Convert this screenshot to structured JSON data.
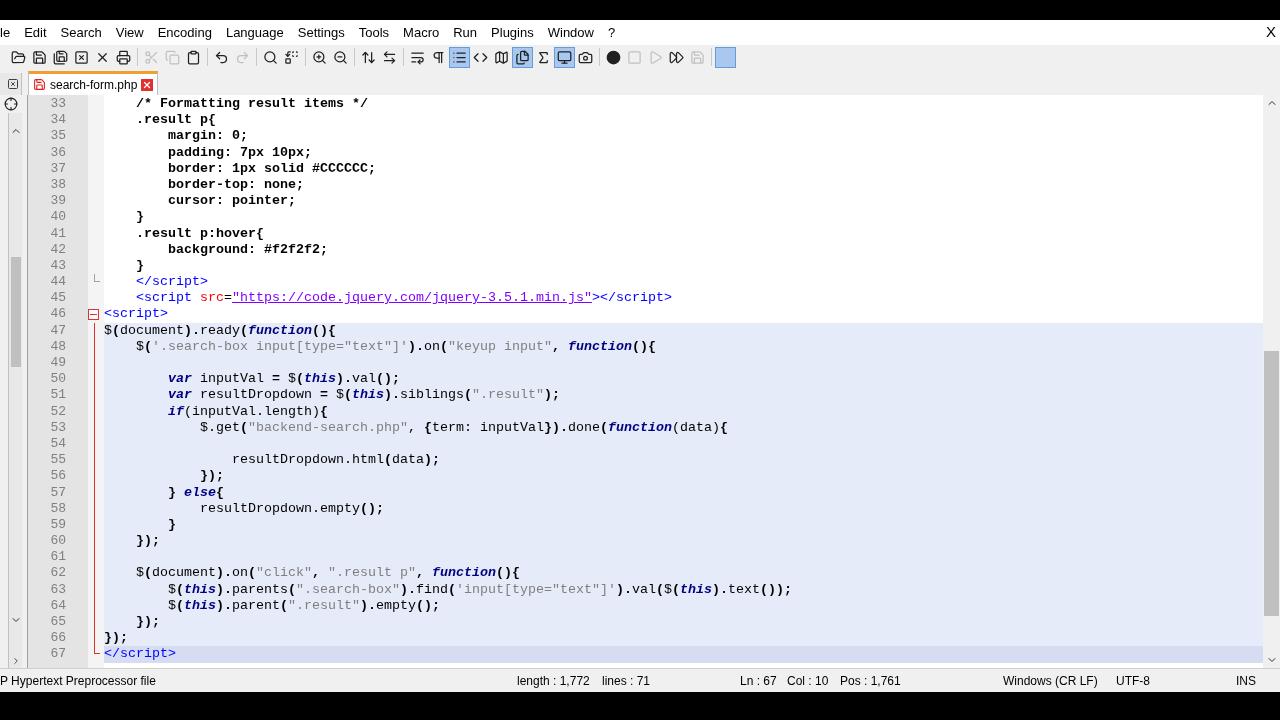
{
  "menu": [
    "le",
    "Edit",
    "Search",
    "View",
    "Encoding",
    "Language",
    "Settings",
    "Tools",
    "Macro",
    "Run",
    "Plugins",
    "Window",
    "?"
  ],
  "close_label": "X",
  "toolbar": [
    {
      "pressed": false,
      "disabled": false
    },
    {
      "pressed": false,
      "disabled": false
    },
    {
      "pressed": false,
      "disabled": false
    },
    {
      "pressed": false,
      "disabled": false
    },
    {
      "pressed": false,
      "disabled": false
    },
    {
      "pressed": false,
      "disabled": false
    },
    {
      "pressed": false,
      "disabled": true
    },
    {
      "pressed": false,
      "disabled": true
    },
    {
      "pressed": false,
      "disabled": false
    },
    {
      "pressed": false,
      "disabled": false
    },
    {
      "pressed": false,
      "disabled": true
    },
    {
      "pressed": false,
      "disabled": false
    },
    {
      "pressed": false,
      "disabled": false
    },
    {
      "pressed": false,
      "disabled": false
    },
    {
      "pressed": false,
      "disabled": false
    },
    {
      "pressed": false,
      "disabled": false
    },
    {
      "pressed": false,
      "disabled": false
    },
    {
      "pressed": false,
      "disabled": false
    },
    {
      "pressed": false,
      "disabled": false
    },
    {
      "pressed": true,
      "disabled": false
    },
    {
      "pressed": false,
      "disabled": false
    },
    {
      "pressed": false,
      "disabled": false
    },
    {
      "pressed": true,
      "disabled": false
    },
    {
      "pressed": false,
      "disabled": false
    },
    {
      "pressed": true,
      "disabled": false
    },
    {
      "pressed": false,
      "disabled": false
    },
    {
      "pressed": false,
      "disabled": false
    },
    {
      "pressed": false,
      "disabled": true
    },
    {
      "pressed": false,
      "disabled": true
    },
    {
      "pressed": false,
      "disabled": false
    },
    {
      "pressed": false,
      "disabled": true
    },
    {
      "pressed": true,
      "disabled": false
    }
  ],
  "tabs": [
    {
      "label": "search-form.php",
      "selected": true,
      "modified": true
    }
  ],
  "lines": [
    {
      "number": "33",
      "kind": "plain",
      "current": false,
      "shaded": false,
      "tokens": [
        {
          "kind": "bold",
          "text": "    /* Formatting result items */"
        }
      ]
    },
    {
      "number": "34",
      "kind": "plain",
      "current": false,
      "shaded": false,
      "tokens": [
        {
          "kind": "bold",
          "text": "    .result p{"
        }
      ]
    },
    {
      "number": "35",
      "kind": "plain",
      "current": false,
      "shaded": false,
      "tokens": [
        {
          "kind": "bold",
          "text": "        margin: 0;"
        }
      ]
    },
    {
      "number": "36",
      "kind": "plain",
      "current": false,
      "shaded": false,
      "tokens": [
        {
          "kind": "bold",
          "text": "        padding: 7px 10px;"
        }
      ]
    },
    {
      "number": "37",
      "kind": "plain",
      "current": false,
      "shaded": false,
      "tokens": [
        {
          "kind": "bold",
          "text": "        border: 1px solid #CCCCCC;"
        }
      ]
    },
    {
      "number": "38",
      "kind": "plain",
      "current": false,
      "shaded": false,
      "tokens": [
        {
          "kind": "bold",
          "text": "        border-top: none;"
        }
      ]
    },
    {
      "number": "39",
      "kind": "plain",
      "current": false,
      "shaded": false,
      "tokens": [
        {
          "kind": "bold",
          "text": "        cursor: pointer;"
        }
      ]
    },
    {
      "number": "40",
      "kind": "plain",
      "current": false,
      "shaded": false,
      "tokens": [
        {
          "kind": "bold",
          "text": "    }"
        }
      ]
    },
    {
      "number": "41",
      "kind": "plain",
      "current": false,
      "shaded": false,
      "tokens": [
        {
          "kind": "bold",
          "text": "    .result p:hover{"
        }
      ]
    },
    {
      "number": "42",
      "kind": "plain",
      "current": false,
      "shaded": false,
      "tokens": [
        {
          "kind": "bold",
          "text": "        background: #f2f2f2;"
        }
      ]
    },
    {
      "number": "43",
      "kind": "plain",
      "current": false,
      "shaded": false,
      "tokens": [
        {
          "kind": "bold",
          "text": "    }"
        }
      ]
    },
    {
      "number": "44",
      "kind": "fold_end",
      "current": false,
      "shaded": false,
      "tokens": [
        {
          "kind": "tag",
          "text": "    </script>"
        }
      ]
    },
    {
      "number": "45",
      "kind": "plain",
      "current": false,
      "shaded": false,
      "tokens": [
        {
          "kind": "tag",
          "text": "    <script"
        },
        {
          "kind": "attr",
          "text": " src"
        },
        {
          "kind": "plain",
          "text": "="
        },
        {
          "kind": "url",
          "text": "\"https://code.jquery.com/jquery-3.5.1.min.js\""
        },
        {
          "kind": "tag",
          "text": "></script>"
        }
      ]
    },
    {
      "number": "46",
      "kind": "fold_start",
      "current": false,
      "shaded": false,
      "tokens": [
        {
          "kind": "tag",
          "text": "<script>"
        }
      ]
    },
    {
      "number": "47",
      "kind": "fold_body",
      "current": false,
      "shaded": true,
      "tokens": [
        {
          "kind": "plain",
          "text": "$"
        },
        {
          "kind": "op",
          "text": "("
        },
        {
          "kind": "plain",
          "text": "document"
        },
        {
          "kind": "op",
          "text": ")."
        },
        {
          "kind": "plain",
          "text": "ready"
        },
        {
          "kind": "op",
          "text": "("
        },
        {
          "kind": "keyword",
          "text": "function"
        },
        {
          "kind": "op",
          "text": "(){"
        }
      ]
    },
    {
      "number": "48",
      "kind": "fold_body",
      "current": false,
      "shaded": true,
      "tokens": [
        {
          "kind": "plain",
          "text": "    $"
        },
        {
          "kind": "op",
          "text": "("
        },
        {
          "kind": "string",
          "text": "'.search-box input[type=\"text\"]'"
        },
        {
          "kind": "op",
          "text": ")."
        },
        {
          "kind": "plain",
          "text": "on"
        },
        {
          "kind": "op",
          "text": "("
        },
        {
          "kind": "string",
          "text": "\"keyup input\""
        },
        {
          "kind": "op",
          "text": ", "
        },
        {
          "kind": "keyword",
          "text": "function"
        },
        {
          "kind": "op",
          "text": "(){"
        }
      ]
    },
    {
      "number": "49",
      "kind": "fold_body",
      "current": false,
      "shaded": true
    },
    {
      "number": "50",
      "kind": "fold_body",
      "current": false,
      "shaded": true,
      "tokens": [
        {
          "kind": "keyword",
          "text": "        var"
        },
        {
          "kind": "plain",
          "text": " inputVal "
        },
        {
          "kind": "op",
          "text": "="
        },
        {
          "kind": "plain",
          "text": " $"
        },
        {
          "kind": "op",
          "text": "("
        },
        {
          "kind": "keyword",
          "text": "this"
        },
        {
          "kind": "op",
          "text": ")."
        },
        {
          "kind": "plain",
          "text": "val"
        },
        {
          "kind": "op",
          "text": "();"
        }
      ]
    },
    {
      "number": "51",
      "kind": "fold_body",
      "current": false,
      "shaded": true,
      "tokens": [
        {
          "kind": "keyword",
          "text": "        var"
        },
        {
          "kind": "plain",
          "text": " resultDropdown "
        },
        {
          "kind": "op",
          "text": "="
        },
        {
          "kind": "plain",
          "text": " $"
        },
        {
          "kind": "op",
          "text": "("
        },
        {
          "kind": "keyword",
          "text": "this"
        },
        {
          "kind": "op",
          "text": ")."
        },
        {
          "kind": "plain",
          "text": "siblings"
        },
        {
          "kind": "op",
          "text": "("
        },
        {
          "kind": "string",
          "text": "\".result\""
        },
        {
          "kind": "op",
          "text": ");"
        }
      ]
    },
    {
      "number": "52",
      "kind": "fold_body",
      "current": false,
      "shaded": true,
      "tokens": [
        {
          "kind": "keyword",
          "text": "        if"
        },
        {
          "kind": "plain",
          "text": "(inputVal.length)"
        },
        {
          "kind": "op",
          "text": "{"
        }
      ]
    },
    {
      "number": "53",
      "kind": "fold_body",
      "current": false,
      "shaded": true,
      "tokens": [
        {
          "kind": "plain",
          "text": "            $.get"
        },
        {
          "kind": "op",
          "text": "("
        },
        {
          "kind": "string",
          "text": "\"backend-search.php\""
        },
        {
          "kind": "plain",
          "text": ", "
        },
        {
          "kind": "op",
          "text": "{"
        },
        {
          "kind": "plain",
          "text": "term: inputVal"
        },
        {
          "kind": "op",
          "text": "})."
        },
        {
          "kind": "plain",
          "text": "done"
        },
        {
          "kind": "op",
          "text": "("
        },
        {
          "kind": "keyword",
          "text": "function"
        },
        {
          "kind": "plain",
          "text": "(data)"
        },
        {
          "kind": "op",
          "text": "{"
        }
      ]
    },
    {
      "number": "54",
      "kind": "fold_body",
      "current": false,
      "shaded": true
    },
    {
      "number": "55",
      "kind": "fold_body",
      "current": false,
      "shaded": true,
      "tokens": [
        {
          "kind": "plain",
          "text": "                resultDropdown.html"
        },
        {
          "kind": "op",
          "text": "("
        },
        {
          "kind": "plain",
          "text": "data"
        },
        {
          "kind": "op",
          "text": ");"
        }
      ]
    },
    {
      "number": "56",
      "kind": "fold_body",
      "current": false,
      "shaded": true,
      "tokens": [
        {
          "kind": "op",
          "text": "            });"
        }
      ]
    },
    {
      "number": "57",
      "kind": "fold_body",
      "current": false,
      "shaded": true,
      "tokens": [
        {
          "kind": "op",
          "text": "        } "
        },
        {
          "kind": "keyword",
          "text": "else"
        },
        {
          "kind": "op",
          "text": "{"
        }
      ]
    },
    {
      "number": "58",
      "kind": "fold_body",
      "current": false,
      "shaded": true,
      "tokens": [
        {
          "kind": "plain",
          "text": "            resultDropdown.empty"
        },
        {
          "kind": "op",
          "text": "();"
        }
      ]
    },
    {
      "number": "59",
      "kind": "fold_body",
      "current": false,
      "shaded": true,
      "tokens": [
        {
          "kind": "op",
          "text": "        }"
        }
      ]
    },
    {
      "number": "60",
      "kind": "fold_body",
      "current": false,
      "shaded": true,
      "tokens": [
        {
          "kind": "op",
          "text": "    });"
        }
      ]
    },
    {
      "number": "61",
      "kind": "fold_body",
      "current": false,
      "shaded": true
    },
    {
      "number": "62",
      "kind": "fold_body",
      "current": false,
      "shaded": true,
      "tokens": [
        {
          "kind": "plain",
          "text": "    $"
        },
        {
          "kind": "op",
          "text": "("
        },
        {
          "kind": "plain",
          "text": "document"
        },
        {
          "kind": "op",
          "text": ")."
        },
        {
          "kind": "plain",
          "text": "on"
        },
        {
          "kind": "op",
          "text": "("
        },
        {
          "kind": "string",
          "text": "\"click\""
        },
        {
          "kind": "op",
          "text": ", "
        },
        {
          "kind": "string",
          "text": "\".result p\""
        },
        {
          "kind": "op",
          "text": ", "
        },
        {
          "kind": "keyword",
          "text": "function"
        },
        {
          "kind": "op",
          "text": "(){"
        }
      ]
    },
    {
      "number": "63",
      "kind": "fold_body",
      "current": false,
      "shaded": true,
      "tokens": [
        {
          "kind": "plain",
          "text": "        $"
        },
        {
          "kind": "op",
          "text": "("
        },
        {
          "kind": "keyword",
          "text": "this"
        },
        {
          "kind": "op",
          "text": ")."
        },
        {
          "kind": "plain",
          "text": "parents"
        },
        {
          "kind": "op",
          "text": "("
        },
        {
          "kind": "string",
          "text": "\".search-box\""
        },
        {
          "kind": "op",
          "text": ")."
        },
        {
          "kind": "plain",
          "text": "find"
        },
        {
          "kind": "op",
          "text": "("
        },
        {
          "kind": "string",
          "text": "'input[type=\"text\"]'"
        },
        {
          "kind": "op",
          "text": ")."
        },
        {
          "kind": "plain",
          "text": "val"
        },
        {
          "kind": "op",
          "text": "("
        },
        {
          "kind": "plain",
          "text": "$"
        },
        {
          "kind": "op",
          "text": "("
        },
        {
          "kind": "keyword",
          "text": "this"
        },
        {
          "kind": "op",
          "text": ")."
        },
        {
          "kind": "plain",
          "text": "text"
        },
        {
          "kind": "op",
          "text": "());"
        }
      ]
    },
    {
      "number": "64",
      "kind": "fold_body",
      "current": false,
      "shaded": true,
      "tokens": [
        {
          "kind": "plain",
          "text": "        $"
        },
        {
          "kind": "op",
          "text": "("
        },
        {
          "kind": "keyword",
          "text": "this"
        },
        {
          "kind": "op",
          "text": ")."
        },
        {
          "kind": "plain",
          "text": "parent"
        },
        {
          "kind": "op",
          "text": "("
        },
        {
          "kind": "string",
          "text": "\".result\""
        },
        {
          "kind": "op",
          "text": ")."
        },
        {
          "kind": "plain",
          "text": "empty"
        },
        {
          "kind": "op",
          "text": "();"
        }
      ]
    },
    {
      "number": "65",
      "kind": "fold_body",
      "current": false,
      "shaded": true,
      "tokens": [
        {
          "kind": "op",
          "text": "    });"
        }
      ]
    },
    {
      "number": "66",
      "kind": "fold_body",
      "current": false,
      "shaded": true,
      "tokens": [
        {
          "kind": "op",
          "text": "});"
        }
      ]
    },
    {
      "number": "67",
      "kind": "fold_end",
      "current": true,
      "shaded": true,
      "tokens": [
        {
          "kind": "tag",
          "text": "</script>"
        }
      ]
    }
  ],
  "status_bar": {
    "file_type": "P Hypertext Preprocessor file",
    "length": "length : 1,772",
    "lines": "lines : 71",
    "ln": "Ln : 67",
    "col": "Col : 10",
    "pos": "Pos : 1,761",
    "eol": "Windows (CR LF)",
    "encoding": "UTF-8",
    "mode": "INS"
  }
}
